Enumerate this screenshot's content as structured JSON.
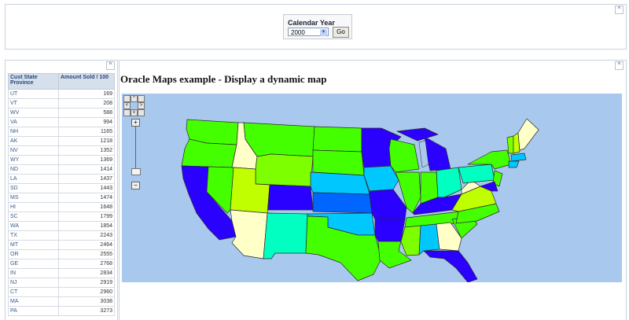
{
  "filter": {
    "label": "Calendar Year",
    "year_value": "2000",
    "go_label": "Go"
  },
  "icons": {
    "collapse": "collapse-up-icon",
    "dropdown": "dropdown-arrow-icon"
  },
  "table": {
    "headers": [
      "Cust State Province",
      "Amount Sold / 100"
    ],
    "rows": [
      [
        "UT",
        "169"
      ],
      [
        "VT",
        "208"
      ],
      [
        "WV",
        "588"
      ],
      [
        "VA",
        "994"
      ],
      [
        "NH",
        "1165"
      ],
      [
        "AK",
        "1218"
      ],
      [
        "NV",
        "1352"
      ],
      [
        "WY",
        "1369"
      ],
      [
        "ND",
        "1414"
      ],
      [
        "LA",
        "1437"
      ],
      [
        "SD",
        "1443"
      ],
      [
        "MS",
        "1474"
      ],
      [
        "HI",
        "1648"
      ],
      [
        "SC",
        "1799"
      ],
      [
        "WA",
        "1854"
      ],
      [
        "TX",
        "2243"
      ],
      [
        "MT",
        "2464"
      ],
      [
        "OR",
        "2555"
      ],
      [
        "GE",
        "2768"
      ],
      [
        "IN",
        "2834"
      ],
      [
        "NJ",
        "2919"
      ],
      [
        "CT",
        "2960"
      ],
      [
        "MA",
        "3038"
      ],
      [
        "PA",
        "3273"
      ]
    ]
  },
  "map": {
    "title": "Oracle Maps example - Display a dynamic map",
    "background_color": "#a8c8ee",
    "nav_buttons": {
      "up": "^",
      "left": "<",
      "right": ">",
      "down": "v"
    },
    "zoom_in": "+",
    "zoom_out": "−",
    "legend_colors": {
      "blue": "#2a00ff",
      "green": "#44ff00",
      "light_green": "#7dff00",
      "cyan": "#00c8ff",
      "teal": "#00ffc0",
      "pale_yellow": "#ffffc8",
      "yellow_green": "#c0ff00",
      "royal_blue": "#0066ff"
    }
  }
}
